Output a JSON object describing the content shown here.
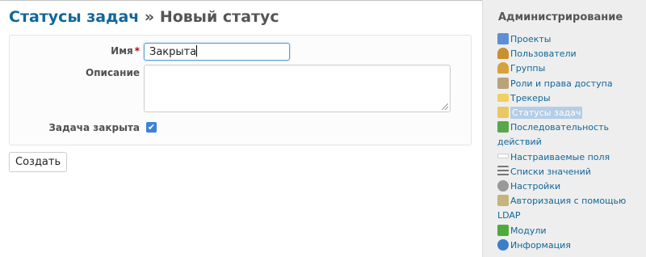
{
  "title": {
    "link": "Статусы задач",
    "separator": " » ",
    "current": "Новый статус"
  },
  "form": {
    "name_label": "Имя",
    "required_mark": "*",
    "name_value": "Закрыта",
    "description_label": "Описание",
    "closed_label": "Задача закрыта",
    "closed_checked": true,
    "checkmark": "✔",
    "submit_label": "Создать"
  },
  "sidebar": {
    "title": "Администрирование",
    "items": [
      {
        "label": "Проекты",
        "icon": "projects-icon",
        "color": "#5c8fd6"
      },
      {
        "label": "Пользователи",
        "icon": "user-icon",
        "color": "#c9902e"
      },
      {
        "label": "Группы",
        "icon": "group-icon",
        "color": "#d6a23c"
      },
      {
        "label": "Роли и права доступа",
        "icon": "key-icon",
        "color": "#b8a37a"
      },
      {
        "label": "Трекеры",
        "icon": "ticket-icon",
        "color": "#f0d060"
      },
      {
        "label": "Статусы задач",
        "icon": "status-icon",
        "color": "#e8c860",
        "selected": true
      },
      {
        "label": "Последовательность действий",
        "icon": "workflow-icon",
        "color": "#58a84a"
      },
      {
        "label": "Настраиваемые поля",
        "icon": "custom-field-icon",
        "color": "#ffffff"
      },
      {
        "label": "Списки значений",
        "icon": "list-icon",
        "color": "#777777"
      },
      {
        "label": "Настройки",
        "icon": "gear-icon",
        "color": "#999999"
      },
      {
        "label": "Авторизация с помощью LDAP",
        "icon": "server-icon",
        "color": "#c6b37e"
      },
      {
        "label": "Модули",
        "icon": "plugin-icon",
        "color": "#4faa3c"
      },
      {
        "label": "Информация",
        "icon": "help-icon",
        "color": "#3c7fc9"
      }
    ]
  }
}
